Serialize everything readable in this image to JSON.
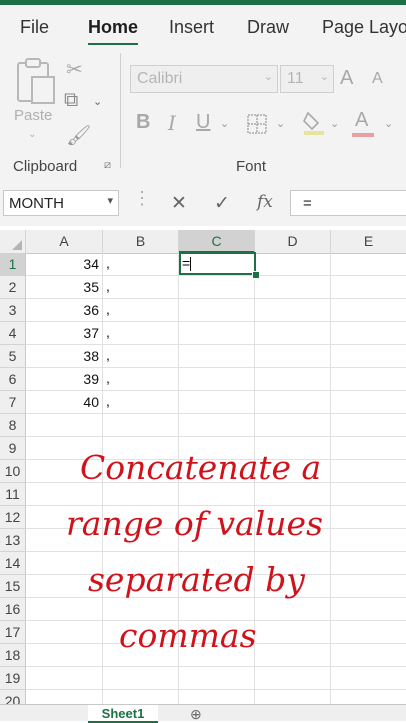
{
  "tabs": [
    "File",
    "Home",
    "Insert",
    "Draw",
    "Page Layout"
  ],
  "ribbon": {
    "paste_label": "Paste",
    "clipboard_label": "Clipboard",
    "font_label": "Font",
    "font_name": "Calibri",
    "font_size": "11",
    "font_grow": "A",
    "font_shrink": "A",
    "bold": "B",
    "italic": "I",
    "underline": "U",
    "font_color": "A"
  },
  "formula_bar": {
    "name_box": "MONTH",
    "cancel": "✕",
    "enter": "✓",
    "fx": "fx",
    "content": "="
  },
  "columns": [
    "A",
    "B",
    "C",
    "D",
    "E"
  ],
  "rows": [
    "1",
    "2",
    "3",
    "4",
    "5",
    "6",
    "7",
    "8",
    "9",
    "10",
    "11",
    "12",
    "13",
    "14",
    "15",
    "16",
    "17",
    "18",
    "19",
    "20"
  ],
  "values_a": [
    "34",
    "35",
    "36",
    "37",
    "38",
    "39",
    "40"
  ],
  "commas_b": [
    ",",
    ",",
    ",",
    ",",
    ",",
    ",",
    ","
  ],
  "active_cell_text": "=",
  "caption": [
    "Concatenate a",
    "range of values",
    "separated by",
    "commas"
  ],
  "sheet": {
    "tab": "Sheet1",
    "add": "⊕"
  }
}
